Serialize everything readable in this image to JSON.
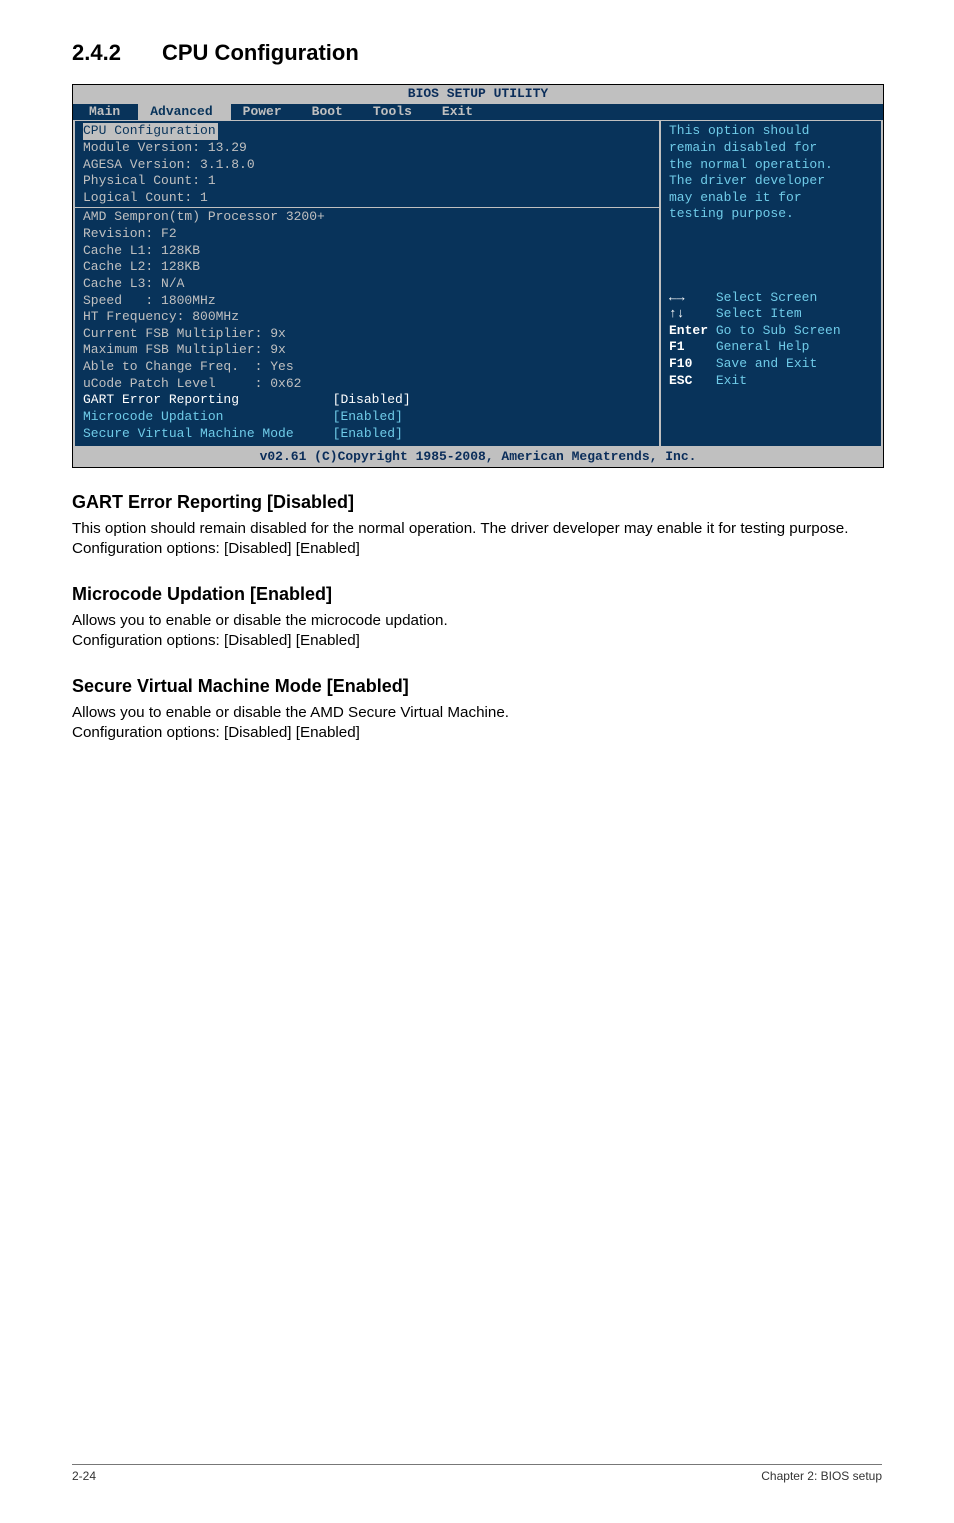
{
  "section": {
    "number": "2.4.2",
    "title": "CPU Configuration"
  },
  "bios": {
    "header": "BIOS SETUP UTILITY",
    "tabs": [
      "Main",
      "Advanced",
      "Power",
      "Boot",
      "Tools",
      "Exit"
    ],
    "active_tab": "Advanced",
    "left": {
      "group_title": "CPU Configuration",
      "lines_top": [
        "Module Version: 13.29",
        "AGESA Version: 3.1.8.0",
        "Physical Count: 1",
        "Logical Count: 1"
      ],
      "lines_mid": [
        "AMD Sempron(tm) Processor 3200+",
        "Revision: F2",
        "Cache L1: 128KB",
        "Cache L2: 128KB",
        "Cache L3: N/A",
        "Speed   : 1800MHz",
        "HT Frequency: 800MHz",
        "Current FSB Multiplier: 9x",
        "Maximum FSB Multiplier: 9x",
        "Able to Change Freq.  : Yes",
        "uCode Patch Level     : 0x62"
      ],
      "settings": [
        {
          "label": "GART Error Reporting",
          "value": "[Disabled]",
          "selected": true
        },
        {
          "label": "Microcode Updation",
          "value": "[Enabled]",
          "selected": false
        },
        {
          "label": "Secure Virtual Machine Mode",
          "value": "[Enabled]",
          "selected": false
        }
      ]
    },
    "right": {
      "help_text": "This option should\nremain disabled for\nthe normal operation.\nThe driver developer\nmay enable it for\ntesting purpose.",
      "nav": [
        {
          "key": "←→   ",
          "text": "Select Screen"
        },
        {
          "key": "↑↓   ",
          "text": "Select Item"
        },
        {
          "key": "Enter",
          "text": "Go to Sub Screen"
        },
        {
          "key": "F1   ",
          "text": "General Help"
        },
        {
          "key": "F10  ",
          "text": "Save and Exit"
        },
        {
          "key": "ESC  ",
          "text": "Exit"
        }
      ]
    },
    "footer": "v02.61 (C)Copyright 1985-2008, American Megatrends, Inc."
  },
  "subsections": [
    {
      "heading": "GART Error Reporting [Disabled]",
      "body": "This option should remain disabled for the normal operation. The driver developer may enable it for testing purpose. Configuration options: [Disabled] [Enabled]"
    },
    {
      "heading": "Microcode Updation [Enabled]",
      "body": "Allows you to enable or disable the microcode updation.\nConfiguration options: [Disabled] [Enabled]"
    },
    {
      "heading": "Secure Virtual Machine Mode [Enabled]",
      "body": "Allows you to enable or disable the AMD Secure Virtual Machine.\nConfiguration options: [Disabled] [Enabled]"
    }
  ],
  "page_footer": {
    "left": "2-24",
    "right": "Chapter 2: BIOS setup"
  }
}
